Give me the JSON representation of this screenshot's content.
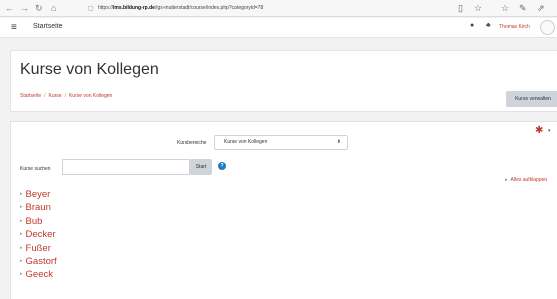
{
  "browser": {
    "url_prefix": "https://",
    "url_domain": "lms.bildung-rp.de",
    "url_path": "/igs-mutterstadt/course/index.php?categoryid=78",
    "back_icon": "back-arrow-icon",
    "forward_icon": "forward-arrow-icon",
    "reload_icon": "reload-icon",
    "home_icon": "home-icon"
  },
  "navbar": {
    "site_name": "Startseite",
    "user_name": "Thomas Kirch"
  },
  "header": {
    "title": "Kurse von Kollegen",
    "breadcrumb": [
      "Startseite",
      "Kurse",
      "Kurse von Kollegen"
    ],
    "manage_button": "Kurse verwalten"
  },
  "content": {
    "category_label": "Kursbereiche",
    "category_selected": "Kurse von Kollegen",
    "search_label": "Kurse suchen",
    "search_value": "",
    "start_button": "Start",
    "expand_all": "Alles aufklappen",
    "categories": [
      "Beyer",
      "Braun",
      "Bub",
      "Decker",
      "Fußer",
      "Gastorf",
      "Geeck"
    ]
  },
  "colors": {
    "accent": "#c0392b",
    "help": "#1f7bbf",
    "button_bg": "#ced4da"
  }
}
